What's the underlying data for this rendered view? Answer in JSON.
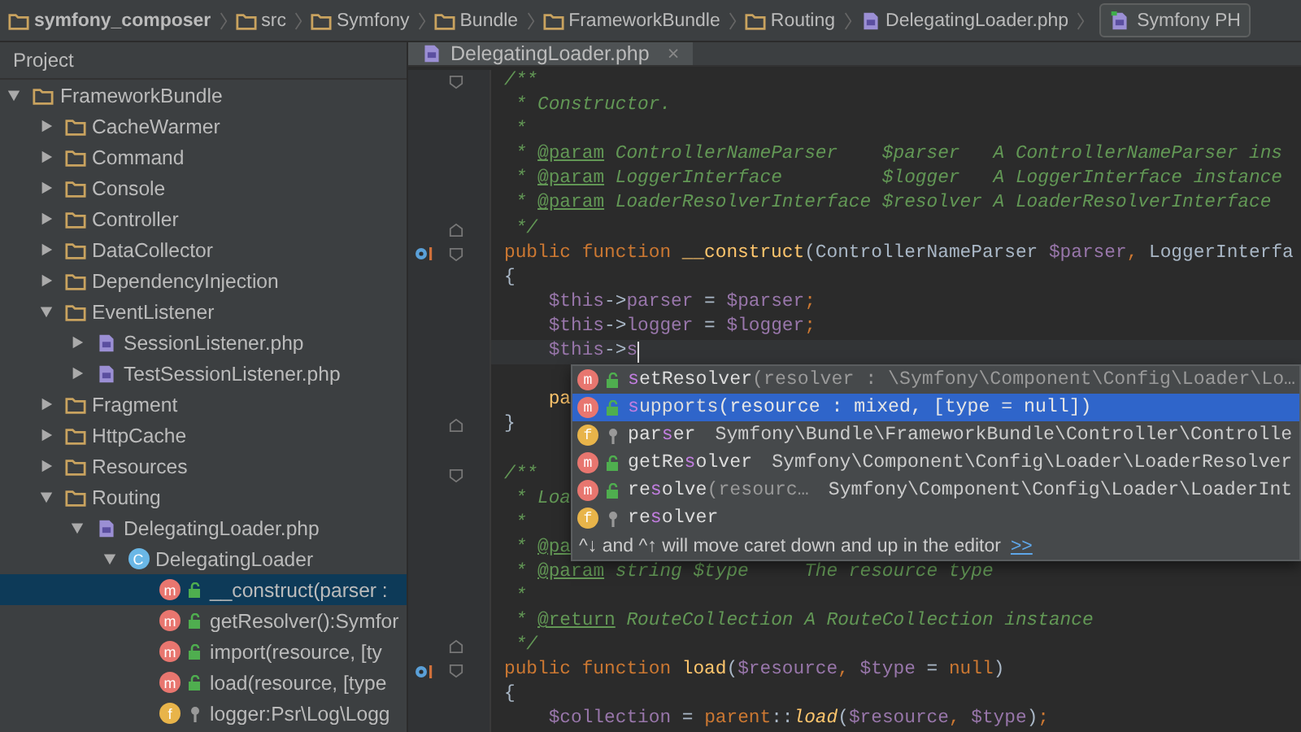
{
  "breadcrumbs": [
    {
      "kind": "folder",
      "label": "symfony_composer",
      "bold": true
    },
    {
      "kind": "folder",
      "label": "src",
      "bold": false
    },
    {
      "kind": "folder",
      "label": "Symfony",
      "bold": false
    },
    {
      "kind": "folder",
      "label": "Bundle",
      "bold": false
    },
    {
      "kind": "folder",
      "label": "FrameworkBundle",
      "bold": false
    },
    {
      "kind": "folder",
      "label": "Routing",
      "bold": false
    },
    {
      "kind": "php",
      "label": "DelegatingLoader.php",
      "bold": false
    }
  ],
  "run_config": {
    "label": "Symfony PH"
  },
  "sidebar": {
    "title": "Project",
    "tree": [
      {
        "kind": "folder",
        "label": "FrameworkBundle",
        "expanded": true,
        "selected": false,
        "children": [
          {
            "kind": "folder",
            "label": "CacheWarmer",
            "expanded": false,
            "selected": false
          },
          {
            "kind": "folder",
            "label": "Command",
            "expanded": false,
            "selected": false
          },
          {
            "kind": "folder",
            "label": "Console",
            "expanded": false,
            "selected": false
          },
          {
            "kind": "folder",
            "label": "Controller",
            "expanded": false,
            "selected": false
          },
          {
            "kind": "folder",
            "label": "DataCollector",
            "expanded": false,
            "selected": false
          },
          {
            "kind": "folder",
            "label": "DependencyInjection",
            "expanded": false,
            "selected": false
          },
          {
            "kind": "folder",
            "label": "EventListener",
            "expanded": true,
            "selected": false,
            "children": [
              {
                "kind": "php",
                "label": "SessionListener.php",
                "expanded": false,
                "selected": false
              },
              {
                "kind": "php",
                "label": "TestSessionListener.php",
                "expanded": false,
                "selected": false
              }
            ]
          },
          {
            "kind": "folder",
            "label": "Fragment",
            "expanded": false,
            "selected": false
          },
          {
            "kind": "folder",
            "label": "HttpCache",
            "expanded": false,
            "selected": false
          },
          {
            "kind": "folder",
            "label": "Resources",
            "expanded": false,
            "selected": false
          },
          {
            "kind": "folder",
            "label": "Routing",
            "expanded": true,
            "selected": false,
            "children": [
              {
                "kind": "php",
                "label": "DelegatingLoader.php",
                "expanded": true,
                "selected": false,
                "children": [
                  {
                    "kind": "class",
                    "badge": "C",
                    "label": "DelegatingLoader",
                    "expanded": true,
                    "selected": false,
                    "children": [
                      {
                        "kind": "method",
                        "badge": "m",
                        "public": true,
                        "label": "__construct(parser :",
                        "selected": true
                      },
                      {
                        "kind": "method",
                        "badge": "m",
                        "public": true,
                        "label": "getResolver():Symfor",
                        "selected": false
                      },
                      {
                        "kind": "method",
                        "badge": "m",
                        "public": true,
                        "label": "import(resource, [ty",
                        "selected": false
                      },
                      {
                        "kind": "method",
                        "badge": "m",
                        "public": true,
                        "label": "load(resource, [type",
                        "selected": false
                      },
                      {
                        "kind": "field",
                        "badge": "f",
                        "public": false,
                        "label": "logger:Psr\\Log\\Logg",
                        "selected": false
                      }
                    ]
                  }
                ]
              }
            ]
          }
        ]
      }
    ]
  },
  "tab": {
    "label": "DelegatingLoader.php",
    "close": "×"
  },
  "code": [
    {
      "marker": false,
      "fold_start": true,
      "fold_end": false,
      "caret": false,
      "tokens": [
        {
          "kind": "comment",
          "t": "/**"
        }
      ]
    },
    {
      "marker": false,
      "fold_start": false,
      "fold_end": false,
      "caret": false,
      "tokens": [
        {
          "kind": "comment",
          "t": " * Constructor."
        }
      ]
    },
    {
      "marker": false,
      "fold_start": false,
      "fold_end": false,
      "caret": false,
      "tokens": [
        {
          "kind": "comment",
          "t": " *"
        }
      ]
    },
    {
      "marker": false,
      "fold_start": false,
      "fold_end": false,
      "caret": false,
      "tokens": [
        {
          "kind": "comment",
          "t": " * "
        },
        {
          "kind": "doctag",
          "t": "@param"
        },
        {
          "kind": "comment",
          "t": " ControllerNameParser    $parser   A ControllerNameParser ins"
        }
      ]
    },
    {
      "marker": false,
      "fold_start": false,
      "fold_end": false,
      "caret": false,
      "tokens": [
        {
          "kind": "comment",
          "t": " * "
        },
        {
          "kind": "doctag",
          "t": "@param"
        },
        {
          "kind": "comment",
          "t": " LoggerInterface         $logger   A LoggerInterface instance"
        }
      ]
    },
    {
      "marker": false,
      "fold_start": false,
      "fold_end": false,
      "caret": false,
      "tokens": [
        {
          "kind": "comment",
          "t": " * "
        },
        {
          "kind": "doctag",
          "t": "@param"
        },
        {
          "kind": "comment",
          "t": " LoaderResolverInterface $resolver A LoaderResolverInterface"
        }
      ]
    },
    {
      "marker": false,
      "fold_start": false,
      "fold_end": true,
      "caret": false,
      "tokens": [
        {
          "kind": "comment",
          "t": " */"
        }
      ]
    },
    {
      "marker": true,
      "fold_start": true,
      "fold_end": false,
      "caret": false,
      "tokens": [
        {
          "kind": "keyword",
          "t": "public function "
        },
        {
          "kind": "function",
          "t": "__construct"
        },
        {
          "kind": "plain",
          "t": "(ControllerNameParser "
        },
        {
          "kind": "variable",
          "t": "$parser"
        },
        {
          "kind": "keyword",
          "t": ", "
        },
        {
          "kind": "plain",
          "t": "LoggerInterfa"
        }
      ]
    },
    {
      "marker": false,
      "fold_start": false,
      "fold_end": false,
      "caret": false,
      "tokens": [
        {
          "kind": "plain",
          "t": "{"
        }
      ]
    },
    {
      "marker": false,
      "fold_start": false,
      "fold_end": false,
      "caret": false,
      "tokens": [
        {
          "kind": "variable",
          "t": "    $this"
        },
        {
          "kind": "plain",
          "t": "->"
        },
        {
          "kind": "variable",
          "t": "parser"
        },
        {
          "kind": "plain",
          "t": " = "
        },
        {
          "kind": "variable",
          "t": "$parser"
        },
        {
          "kind": "keyword",
          "t": ";"
        }
      ]
    },
    {
      "marker": false,
      "fold_start": false,
      "fold_end": false,
      "caret": false,
      "tokens": [
        {
          "kind": "variable",
          "t": "    $this"
        },
        {
          "kind": "plain",
          "t": "->"
        },
        {
          "kind": "variable",
          "t": "logger"
        },
        {
          "kind": "plain",
          "t": " = "
        },
        {
          "kind": "variable",
          "t": "$logger"
        },
        {
          "kind": "keyword",
          "t": ";"
        }
      ]
    },
    {
      "marker": false,
      "fold_start": false,
      "fold_end": false,
      "caret": true,
      "tokens": [
        {
          "kind": "variable",
          "t": "    $this"
        },
        {
          "kind": "plain",
          "t": "->"
        },
        {
          "kind": "variable",
          "t": "s"
        }
      ]
    },
    {
      "marker": false,
      "fold_start": false,
      "fold_end": false,
      "caret": false
    },
    {
      "marker": false,
      "fold_start": false,
      "fold_end": false,
      "caret": false,
      "tokens": [
        {
          "kind": "function",
          "t": "    pa"
        }
      ]
    },
    {
      "marker": false,
      "fold_start": false,
      "fold_end": true,
      "caret": false,
      "tokens": [
        {
          "kind": "plain",
          "t": "}"
        }
      ]
    },
    {
      "marker": false,
      "fold_start": false,
      "fold_end": false,
      "caret": false
    },
    {
      "marker": false,
      "fold_start": true,
      "fold_end": false,
      "caret": false,
      "tokens": [
        {
          "kind": "comment",
          "t": "/**"
        }
      ]
    },
    {
      "marker": false,
      "fold_start": false,
      "fold_end": false,
      "caret": false,
      "tokens": [
        {
          "kind": "comment",
          "t": " * Loa"
        }
      ]
    },
    {
      "marker": false,
      "fold_start": false,
      "fold_end": false,
      "caret": false,
      "tokens": [
        {
          "kind": "comment",
          "t": " *"
        }
      ]
    },
    {
      "marker": false,
      "fold_start": false,
      "fold_end": false,
      "caret": false,
      "tokens": [
        {
          "kind": "comment",
          "t": " * "
        },
        {
          "kind": "doctag",
          "t": "@pa"
        }
      ]
    },
    {
      "marker": false,
      "fold_start": false,
      "fold_end": false,
      "caret": false,
      "tokens": [
        {
          "kind": "comment",
          "t": " * "
        },
        {
          "kind": "doctag",
          "t": "@param"
        },
        {
          "kind": "comment",
          "t": " string $type     The resource type"
        }
      ]
    },
    {
      "marker": false,
      "fold_start": false,
      "fold_end": false,
      "caret": false,
      "tokens": [
        {
          "kind": "comment",
          "t": " *"
        }
      ]
    },
    {
      "marker": false,
      "fold_start": false,
      "fold_end": false,
      "caret": false,
      "tokens": [
        {
          "kind": "comment",
          "t": " * "
        },
        {
          "kind": "doctag",
          "t": "@return"
        },
        {
          "kind": "comment",
          "t": " RouteCollection A RouteCollection instance"
        }
      ]
    },
    {
      "marker": false,
      "fold_start": false,
      "fold_end": true,
      "caret": false,
      "tokens": [
        {
          "kind": "comment",
          "t": " */"
        }
      ]
    },
    {
      "marker": true,
      "fold_start": true,
      "fold_end": false,
      "caret": false,
      "tokens": [
        {
          "kind": "keyword",
          "t": "public function "
        },
        {
          "kind": "function",
          "t": "load"
        },
        {
          "kind": "plain",
          "t": "("
        },
        {
          "kind": "variable",
          "t": "$resource"
        },
        {
          "kind": "keyword",
          "t": ", "
        },
        {
          "kind": "variable",
          "t": "$type"
        },
        {
          "kind": "plain",
          "t": " = "
        },
        {
          "kind": "keyword",
          "t": "null"
        },
        {
          "kind": "plain",
          "t": ")"
        }
      ]
    },
    {
      "marker": false,
      "fold_start": false,
      "fold_end": false,
      "caret": false,
      "tokens": [
        {
          "kind": "plain",
          "t": "{"
        }
      ]
    },
    {
      "marker": false,
      "fold_start": false,
      "fold_end": false,
      "caret": false,
      "tokens": [
        {
          "kind": "variable",
          "t": "    $collection"
        },
        {
          "kind": "plain",
          "t": " = "
        },
        {
          "kind": "keyword",
          "t": "parent"
        },
        {
          "kind": "plain",
          "t": "::"
        },
        {
          "kind": "call",
          "t": "load"
        },
        {
          "kind": "plain",
          "t": "("
        },
        {
          "kind": "variable",
          "t": "$resource"
        },
        {
          "kind": "keyword",
          "t": ", "
        },
        {
          "kind": "variable",
          "t": "$type"
        },
        {
          "kind": "plain",
          "t": ")"
        },
        {
          "kind": "keyword",
          "t": ";"
        }
      ]
    }
  ],
  "completion": {
    "items": [
      {
        "badge": "m",
        "kind": "method",
        "public": true,
        "name": {
          "match": "s",
          "after": "etResolver"
        },
        "args": "(resolver : \\Symfony\\Component\\Config\\Loader\\Lo…",
        "selected": false
      },
      {
        "badge": "m",
        "kind": "method",
        "public": true,
        "name": {
          "match": "s",
          "after": "upports"
        },
        "args": "(resource : mixed, [type = null])",
        "selected": true
      },
      {
        "badge": "f",
        "kind": "field",
        "public": false,
        "name": {
          "before": "par",
          "match": "s",
          "after": "er"
        },
        "type": "Symfony\\Bundle\\FrameworkBundle\\Controller\\Controlle",
        "selected": false
      },
      {
        "badge": "m",
        "kind": "method",
        "public": true,
        "name": {
          "before": "getRe",
          "match": "s",
          "after": "olver"
        },
        "type": "Symfony\\Component\\Config\\Loader\\LoaderResolver",
        "selected": false
      },
      {
        "badge": "m",
        "kind": "method",
        "public": true,
        "name": {
          "before": "re",
          "match": "s",
          "after": "olve"
        },
        "args": "(resourc…",
        "type": "Symfony\\Component\\Config\\Loader\\LoaderInt",
        "selected": false
      },
      {
        "badge": "f",
        "kind": "field",
        "public": false,
        "name": {
          "before": "re",
          "match": "s",
          "after": "olver"
        },
        "selected": false
      }
    ],
    "hint": "^↓ and ^↑ will move caret down and up in the editor",
    "hint_link": ">>"
  }
}
